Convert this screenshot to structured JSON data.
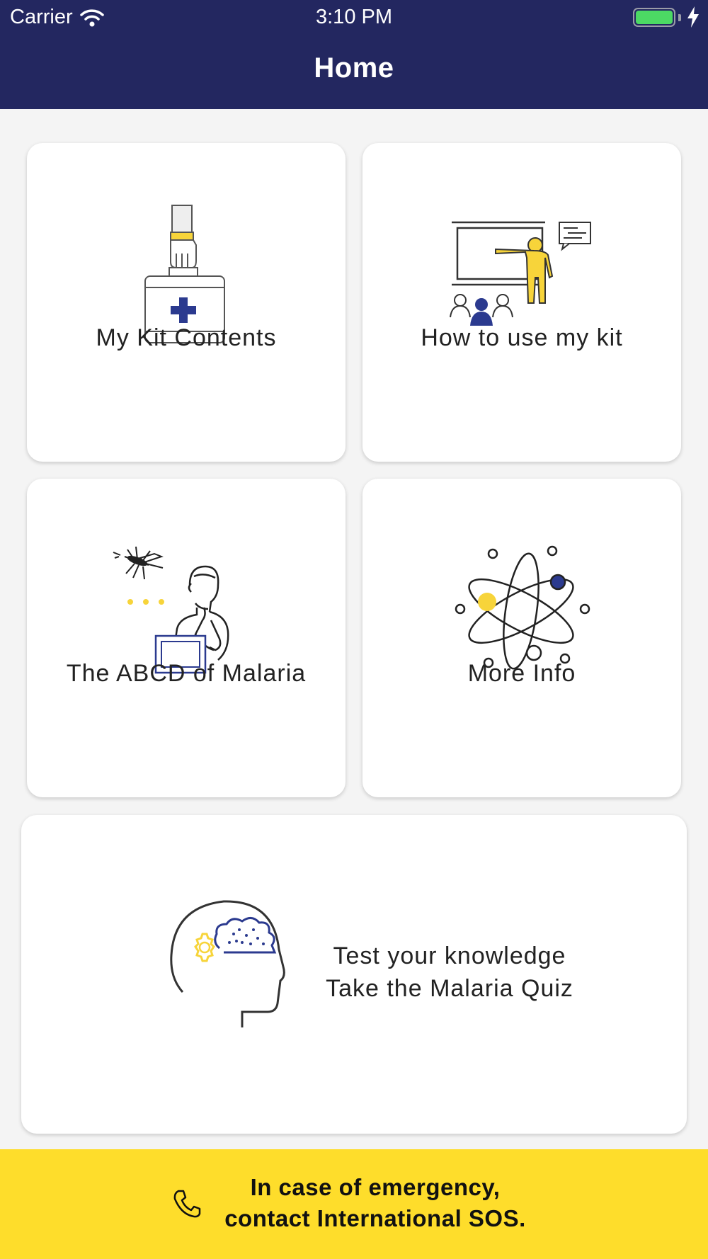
{
  "status_bar": {
    "carrier": "Carrier",
    "time": "3:10 PM"
  },
  "header": {
    "title": "Home"
  },
  "tiles": [
    {
      "label": "My Kit Contents",
      "icon": "first-aid-kit-icon"
    },
    {
      "label": "How to use my kit",
      "icon": "presentation-icon"
    },
    {
      "label": "The ABCD of Malaria",
      "icon": "mosquito-thinker-icon"
    },
    {
      "label": "More Info",
      "icon": "atom-icon"
    }
  ],
  "quiz": {
    "line1": "Test your knowledge",
    "line2": "Take the Malaria Quiz",
    "icon": "brain-head-icon"
  },
  "emergency": {
    "line1": "In case of emergency,",
    "line2": "contact International SOS.",
    "icon": "phone-icon"
  },
  "colors": {
    "navy": "#232760",
    "yellow": "#fedd2b",
    "accent_blue": "#2b3a8f",
    "accent_yellow": "#f7d43a"
  }
}
